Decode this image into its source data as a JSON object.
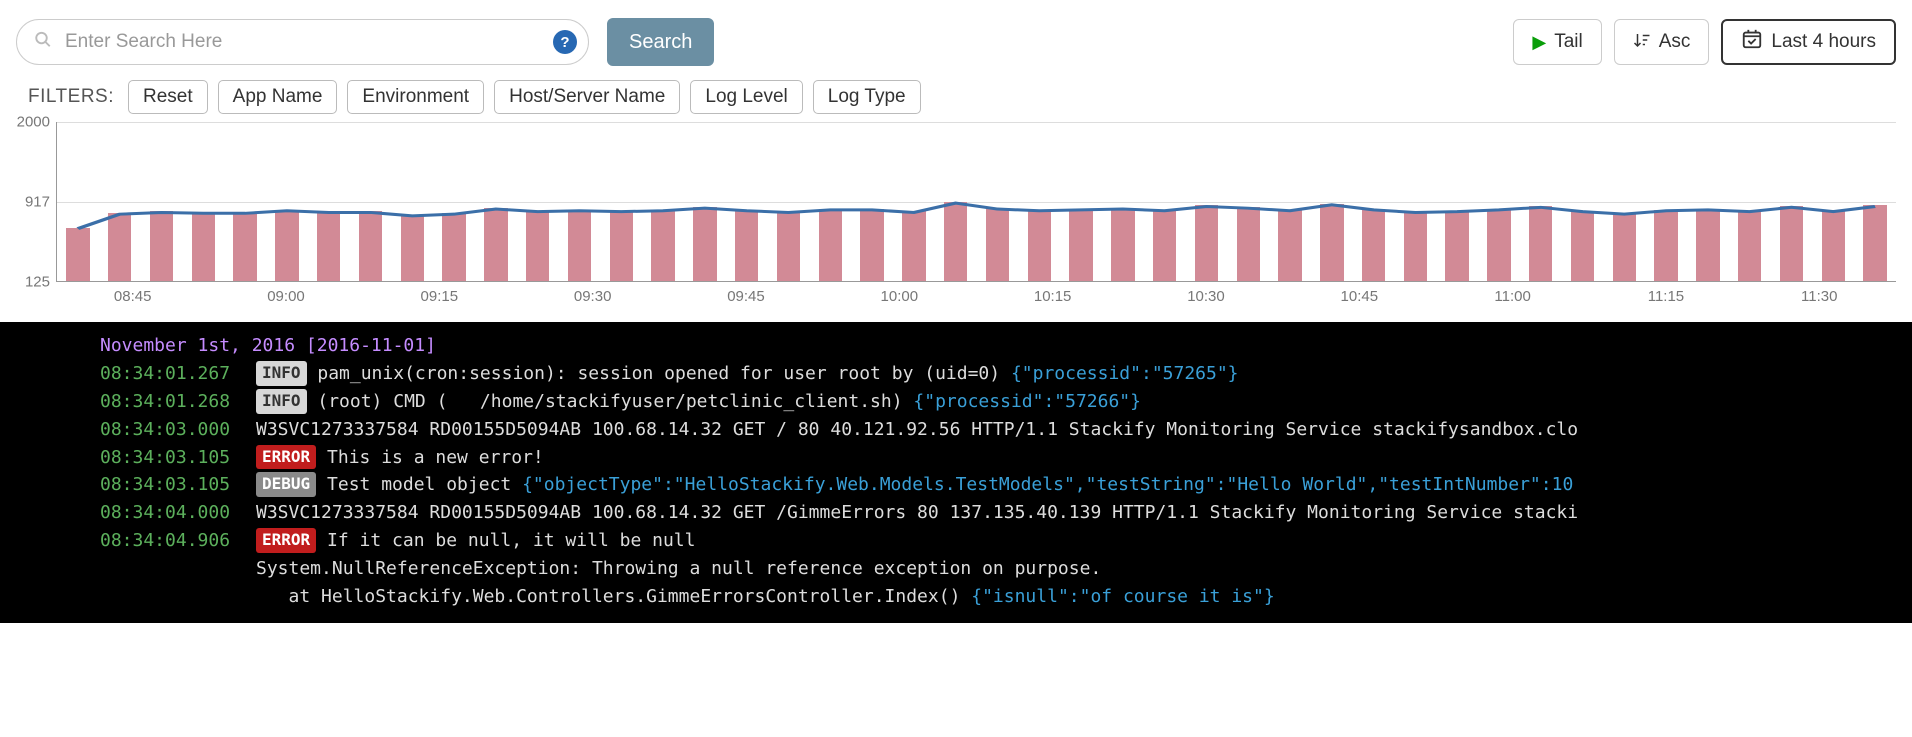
{
  "search": {
    "placeholder": "Enter Search Here",
    "value": ""
  },
  "buttons": {
    "search": "Search",
    "tail": "Tail",
    "asc": "Asc",
    "time_range": "Last 4 hours"
  },
  "filters": {
    "label": "FILTERS:",
    "items": [
      "Reset",
      "App Name",
      "Environment",
      "Host/Server Name",
      "Log Level",
      "Log Type"
    ]
  },
  "chart_data": {
    "type": "bar",
    "title": "",
    "xlabel": "",
    "ylabel": "",
    "ylim": [
      125,
      2000
    ],
    "yticks": [
      125,
      917,
      2000
    ],
    "categories": [
      "08:45",
      "09:00",
      "09:15",
      "09:30",
      "09:45",
      "10:00",
      "10:15",
      "10:30",
      "10:45",
      "11:00",
      "11:15",
      "11:30"
    ],
    "values": [
      750,
      920,
      940,
      930,
      930,
      960,
      940,
      940,
      900,
      920,
      980,
      950,
      960,
      950,
      960,
      990,
      960,
      940,
      970,
      970,
      940,
      1050,
      980,
      960,
      970,
      980,
      960,
      1010,
      990,
      960,
      1030,
      970,
      940,
      950,
      970,
      1000,
      950,
      920,
      960,
      970,
      950,
      1000,
      950,
      1010
    ],
    "series": [
      {
        "name": "line",
        "values": [
          750,
          920,
          940,
          930,
          930,
          960,
          940,
          940,
          900,
          920,
          980,
          950,
          960,
          950,
          960,
          990,
          960,
          940,
          970,
          970,
          940,
          1050,
          980,
          960,
          970,
          980,
          960,
          1010,
          990,
          960,
          1030,
          970,
          940,
          950,
          970,
          1000,
          950,
          920,
          960,
          970,
          950,
          1000,
          950,
          1010
        ]
      }
    ]
  },
  "logs": {
    "date_header": "November 1st, 2016 [2016-11-01]",
    "rows": [
      {
        "ts": "08:34:01.267",
        "level": "INFO",
        "text": "pam_unix(cron:session): session opened for user root by (uid=0) ",
        "json": "{\"processid\":\"57265\"}"
      },
      {
        "ts": "08:34:01.268",
        "level": "INFO",
        "text": "(root) CMD (   /home/stackifyuser/petclinic_client.sh) ",
        "json": "{\"processid\":\"57266\"}"
      },
      {
        "ts": "08:34:03.000",
        "level": "",
        "text": "W3SVC1273337584 RD00155D5094AB 100.68.14.32 GET / 80 40.121.92.56 HTTP/1.1 Stackify Monitoring Service stackifysandbox.clo",
        "json": ""
      },
      {
        "ts": "08:34:03.105",
        "level": "ERROR",
        "text": "This is a new error!",
        "json": ""
      },
      {
        "ts": "08:34:03.105",
        "level": "DEBUG",
        "text": "Test model object ",
        "json": "{\"objectType\":\"HelloStackify.Web.Models.TestModels\",\"testString\":\"Hello World\",\"testIntNumber\":10"
      },
      {
        "ts": "08:34:04.000",
        "level": "",
        "text": "W3SVC1273337584 RD00155D5094AB 100.68.14.32 GET /GimmeErrors 80 137.135.40.139 HTTP/1.1 Stackify Monitoring Service stacki",
        "json": ""
      },
      {
        "ts": "08:34:04.906",
        "level": "ERROR",
        "text": "If it can be null, it will be null",
        "json": "",
        "extra": [
          "System.NullReferenceException: Throwing a null reference exception on purpose.",
          "   at HelloStackify.Web.Controllers.GimmeErrorsController.Index() "
        ],
        "extra_json": "{\"isnull\":\"of course it is\"}"
      }
    ]
  }
}
